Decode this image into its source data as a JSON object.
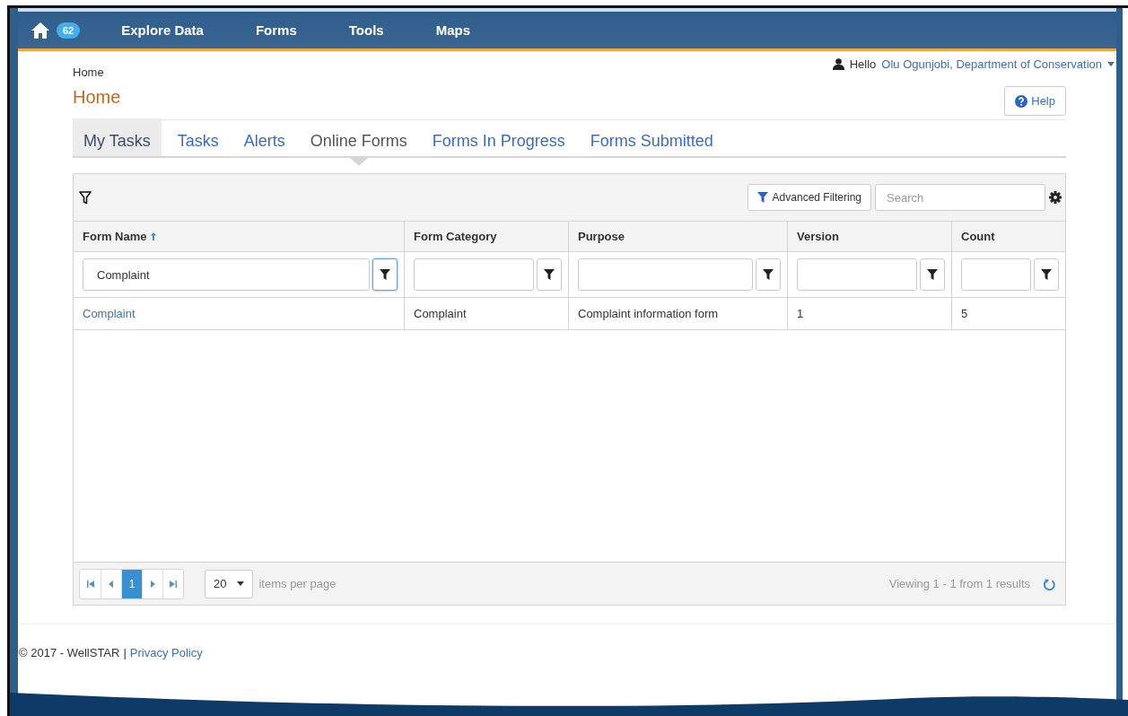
{
  "nav": {
    "badge": "62",
    "items": [
      "Explore Data",
      "Forms",
      "Tools",
      "Maps"
    ]
  },
  "breadcrumb": "Home",
  "user": {
    "greeting": "Hello",
    "name": "Olu Ogunjobi, Department of Conservation"
  },
  "title": "Home",
  "help": "Help",
  "tab_group": "My Tasks",
  "tabs": [
    {
      "label": "Tasks",
      "selected": false
    },
    {
      "label": "Alerts",
      "selected": false
    },
    {
      "label": "Online Forms",
      "selected": true
    },
    {
      "label": "Forms In Progress",
      "selected": false
    },
    {
      "label": "Forms Submitted",
      "selected": false
    }
  ],
  "grid": {
    "advanced_filter": "Advanced Filtering",
    "search": {
      "placeholder": "Search"
    },
    "columns": [
      {
        "label": "Form Name",
        "sorted": true,
        "filter": "Complaint",
        "focused": true,
        "link": true
      },
      {
        "label": "Form Category",
        "sorted": false,
        "focused": false,
        "link": false
      },
      {
        "label": "Purpose",
        "sorted": false,
        "focused": false,
        "link": false
      },
      {
        "label": "Version",
        "sorted": false,
        "focused": false,
        "link": false
      },
      {
        "label": "Count",
        "sorted": false,
        "focused": false,
        "link": false
      }
    ],
    "rows": [
      {
        "cells": [
          "Complaint",
          "Complaint",
          "Complaint information form",
          "1",
          "5"
        ]
      }
    ],
    "pager": {
      "pages": [
        {
          "label": "1",
          "selected": true
        }
      ],
      "page_size": "20",
      "page_size_label": "items per page",
      "summary": "Viewing 1 - 1 from 1 results"
    }
  },
  "footer": {
    "copyright": "© 2017 - WellSTAR",
    "separator": "|",
    "link": "Privacy Policy"
  }
}
